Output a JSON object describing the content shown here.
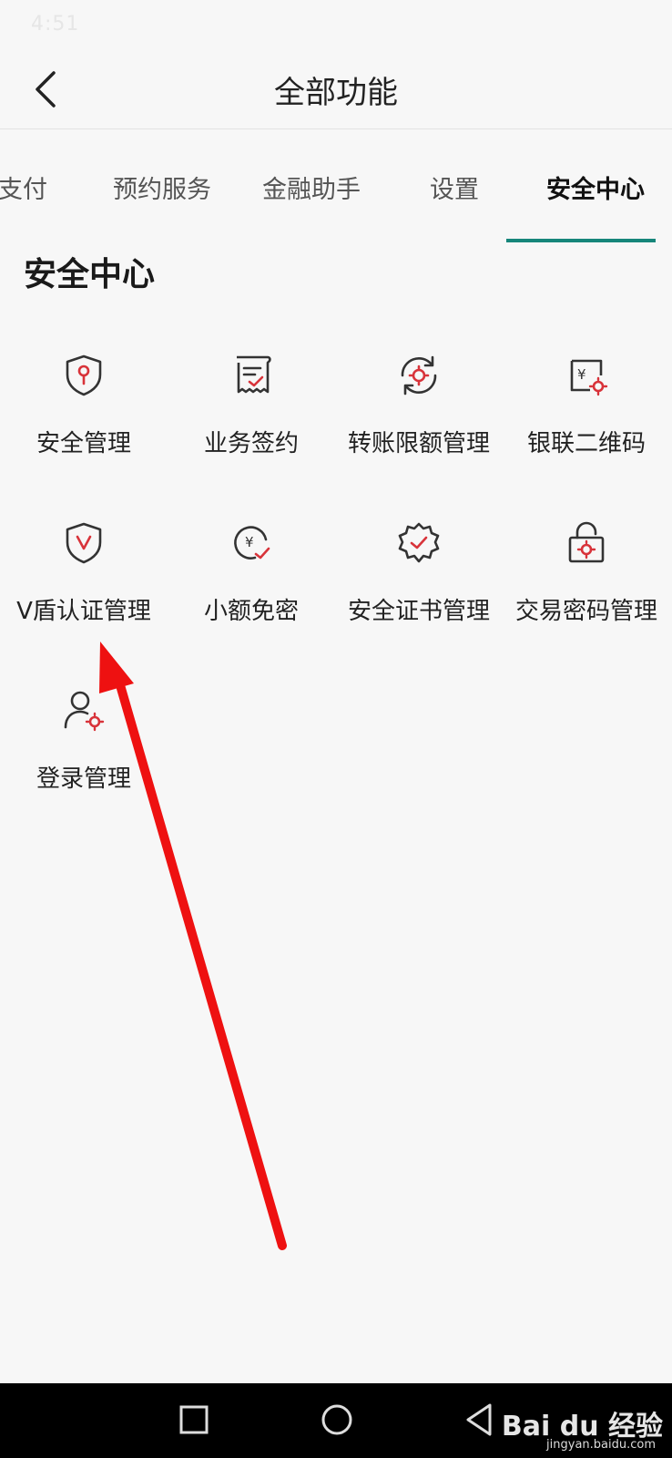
{
  "status_bar": {
    "time": "4:51",
    "right": ""
  },
  "header": {
    "title": "全部功能"
  },
  "tabs": [
    {
      "label": "支付"
    },
    {
      "label": "预约服务"
    },
    {
      "label": "金融助手"
    },
    {
      "label": "设置"
    },
    {
      "label": "安全中心",
      "active": true
    }
  ],
  "section": {
    "title": "安全中心"
  },
  "items": [
    {
      "label": "安全管理",
      "icon": "shield-key-icon"
    },
    {
      "label": "业务签约",
      "icon": "contract-scroll-icon"
    },
    {
      "label": "转账限额管理",
      "icon": "transfer-limit-gear-icon"
    },
    {
      "label": "银联二维码",
      "icon": "unionpay-qr-icon"
    },
    {
      "label": "V盾认证管理",
      "icon": "v-shield-icon"
    },
    {
      "label": "小额免密",
      "icon": "yuan-check-icon"
    },
    {
      "label": "安全证书管理",
      "icon": "certificate-gear-icon"
    },
    {
      "label": "交易密码管理",
      "icon": "lock-gear-icon"
    },
    {
      "label": "登录管理",
      "icon": "user-gear-icon"
    }
  ],
  "watermark": {
    "text": "Bai du 经验",
    "sub": "jingyan.baidu.com"
  },
  "colors": {
    "accent": "#16867a",
    "icon_red": "#d8333a",
    "arrow": "#ee1111"
  }
}
